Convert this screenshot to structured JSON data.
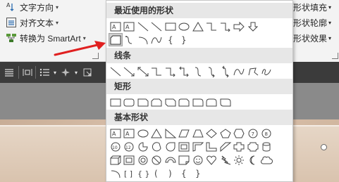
{
  "ribbon": {
    "text_direction": "文字方向",
    "align_text": "对齐文本",
    "convert_smartart": "转换为 SmartArt",
    "shape_fill": "形状填充",
    "shape_outline": "形状轮廓",
    "shape_effects": "形状效果"
  },
  "dropdown": {
    "recent_header": "最近使用的形状",
    "lines_header": "线条",
    "rectangles_header": "矩形",
    "basic_header": "基本形状"
  },
  "colors": {
    "ribbon_bg": "#f3f3f3",
    "dark_strip": "#3b3b3b",
    "arrow_red": "#e02020",
    "section_header_bg": "#e7e7e7"
  }
}
